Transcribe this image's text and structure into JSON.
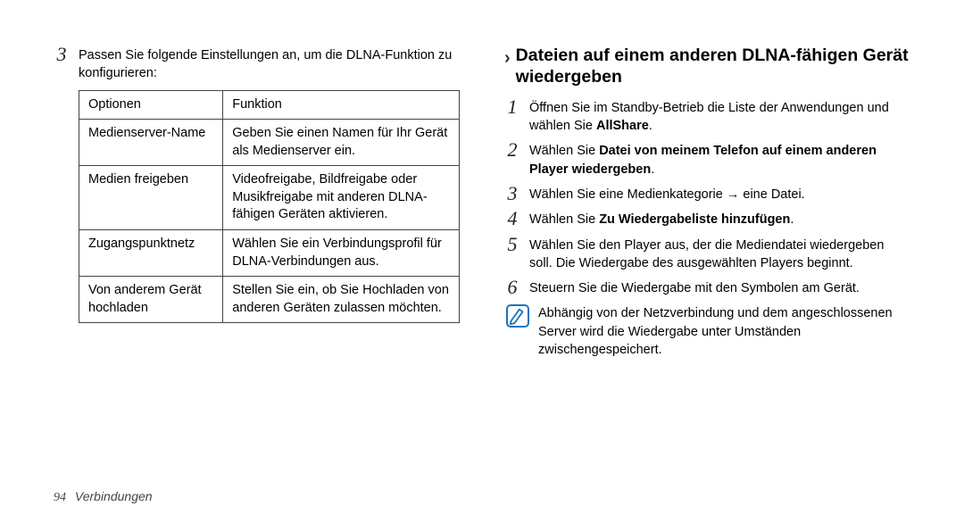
{
  "left": {
    "step3_num": "3",
    "step3_text": "Passen Sie folgende Einstellungen an, um die DLNA-Funktion zu konfigurieren:",
    "table": {
      "head": {
        "c1": "Optionen",
        "c2": "Funktion"
      },
      "rows": [
        {
          "c1": "Medienserver-Name",
          "c2": "Geben Sie einen Namen für Ihr Gerät als Medienserver ein."
        },
        {
          "c1": "Medien freigeben",
          "c2": "Videofreigabe, Bildfreigabe oder Musikfreigabe mit anderen DLNA-fähigen Geräten aktivieren."
        },
        {
          "c1": "Zugangspunktnetz",
          "c2": "Wählen Sie ein Verbindungsprofil für DLNA-Verbindungen aus."
        },
        {
          "c1": "Von anderem Gerät hochladen",
          "c2": "Stellen Sie ein, ob Sie Hochladen von anderen Geräten zulassen möchten."
        }
      ]
    }
  },
  "right": {
    "heading": "Dateien auf einem anderen DLNA-fähigen Gerät wiedergeben",
    "step1_num": "1",
    "step1_a": "Öffnen Sie im Standby-Betrieb die Liste der Anwendungen und wählen Sie ",
    "step1_b": "AllShare",
    "step1_c": ".",
    "step2_num": "2",
    "step2_a": "Wählen Sie ",
    "step2_b": "Datei von meinem Telefon auf einem anderen Player wiedergeben",
    "step2_c": ".",
    "step3_num": "3",
    "step3_text": "Wählen Sie eine Medienkategorie → eine Datei.",
    "step4_num": "4",
    "step4_a": "Wählen Sie ",
    "step4_b": "Zu Wiedergabeliste hinzufügen",
    "step4_c": ".",
    "step5_num": "5",
    "step5_text": "Wählen Sie den Player aus, der die Mediendatei wiedergeben soll. Die Wiedergabe des ausgewählten Players beginnt.",
    "step6_num": "6",
    "step6_text": "Steuern Sie die Wiedergabe mit den Symbolen am Gerät.",
    "note_text": "Abhängig von der Netzverbindung und dem angeschlossenen Server wird die Wiedergabe unter Umständen zwischengespeichert."
  },
  "footer": {
    "page": "94",
    "section": "Verbindungen"
  }
}
